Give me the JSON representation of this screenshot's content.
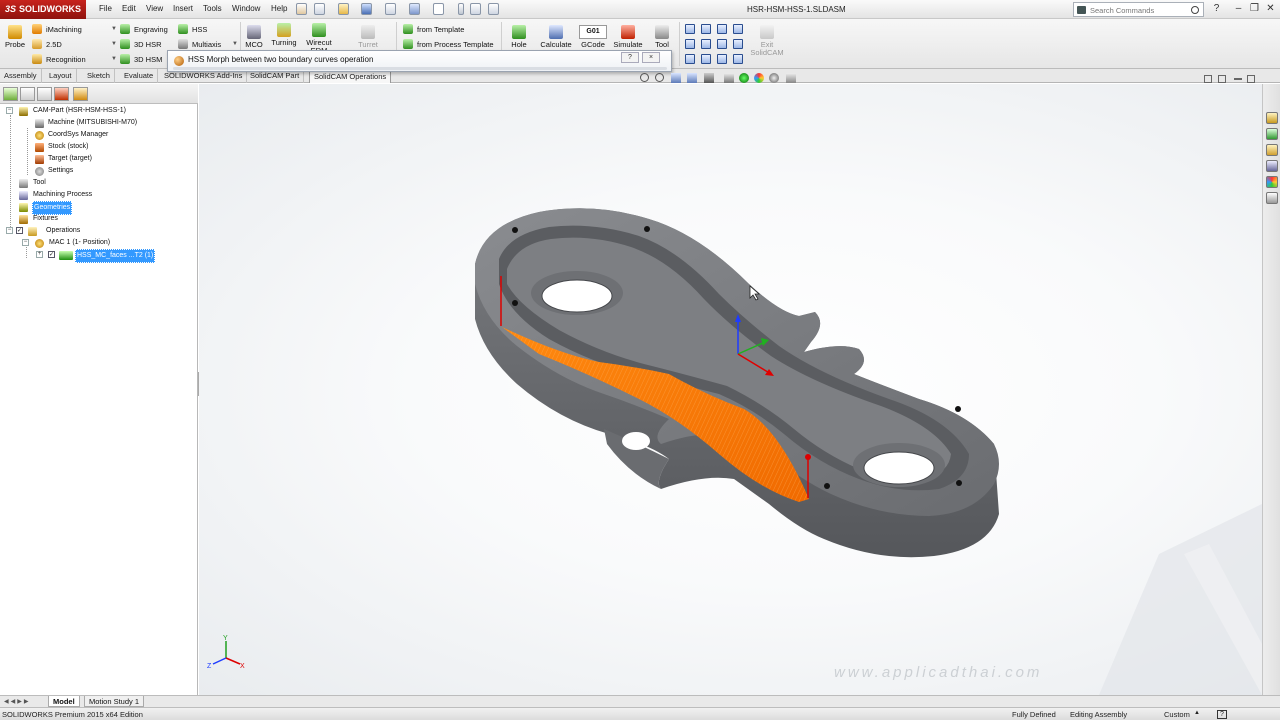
{
  "app": {
    "brand": "SOLIDWORKS",
    "brand_prefix": "3S",
    "document_title": "HSR-HSM-HSS-1.SLDASM"
  },
  "menu": [
    "File",
    "Edit",
    "View",
    "Insert",
    "Tools",
    "Window",
    "Help"
  ],
  "search": {
    "placeholder": "Search Commands"
  },
  "ribbon": {
    "probe": "Probe",
    "imachining": "iMachining",
    "two_five_d": "2.5D",
    "recognition": "Recognition",
    "engraving": "Engraving",
    "hsr_3d": "3D HSR",
    "hsm_3d": "3D HSM",
    "hss": "HSS",
    "multiaxis": "Multiaxis",
    "mco": "MCO",
    "turning": "Turning",
    "wirecut": "Wirecut EDM",
    "turret": "Turret",
    "from_template": "from Template",
    "from_process_template": "from Process Template",
    "hole": "Hole",
    "calculate": "Calculate",
    "gcode_top": "G01",
    "gcode": "GCode",
    "simulate": "Simulate",
    "tool": "Tool",
    "exit_line1": "Exit",
    "exit_line2": "SolidCAM"
  },
  "tabs": [
    "Assembly",
    "Layout",
    "Sketch",
    "Evaluate",
    "SOLIDWORKS Add-Ins",
    "SolidCAM Part",
    "SolidCAM Operations"
  ],
  "active_tab": "SolidCAM Operations",
  "tooltip": {
    "text": "HSS Morph between two boundary curves operation",
    "help": "?",
    "close": "×"
  },
  "tree": {
    "root": "CAM-Part (HSR-HSM-HSS-1)",
    "machine": "Machine (MITSUBISHI-M70)",
    "coordsys": "CoordSys Manager",
    "stock": "Stock (stock)",
    "target": "Target (target)",
    "settings": "Settings",
    "tool": "Tool",
    "machining_process": "Machining Process",
    "geometries": "Geometries",
    "fixtures": "Fixtures",
    "operations": "Operations",
    "mac": "MAC 1 (1- Position)",
    "operation": "HSS_MC_faces ...T2 (1)"
  },
  "bottom_tabs": [
    "Model",
    "Motion Study 1"
  ],
  "status": {
    "edition": "SOLIDWORKS Premium 2015 x64 Edition",
    "defined": "Fully Defined",
    "mode": "Editing Assembly",
    "units": "Custom",
    "help": "?"
  },
  "triad": {
    "x": "X",
    "y": "Y",
    "z": "Z"
  },
  "watermark": "www.applicadthai.com",
  "colors": {
    "accent_red": "#c7231d",
    "toolpath_orange": "#ff7a00",
    "part_gray": "#6d6f73",
    "selection_blue": "#3399ff"
  }
}
